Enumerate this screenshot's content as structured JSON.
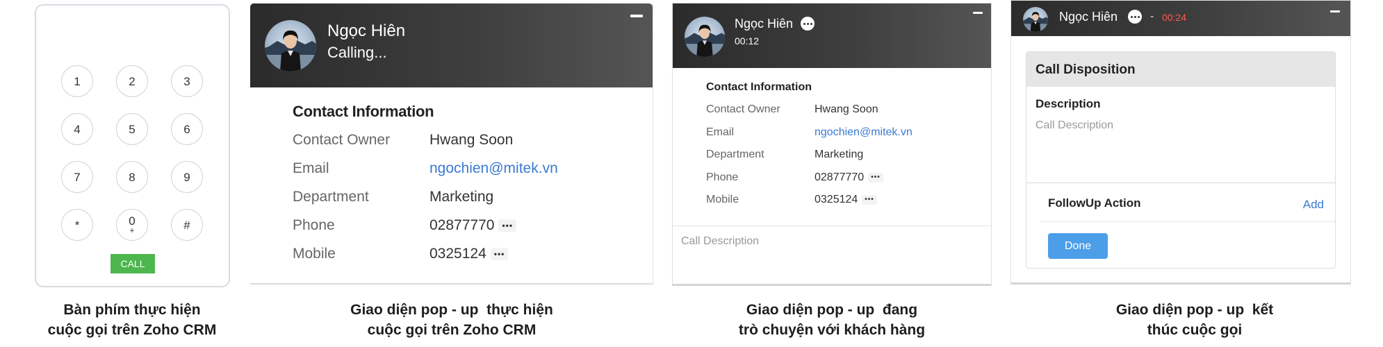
{
  "keypad": {
    "keys": [
      {
        "main": "1",
        "sub": ""
      },
      {
        "main": "2",
        "sub": ""
      },
      {
        "main": "3",
        "sub": ""
      },
      {
        "main": "4",
        "sub": ""
      },
      {
        "main": "5",
        "sub": ""
      },
      {
        "main": "6",
        "sub": ""
      },
      {
        "main": "7",
        "sub": ""
      },
      {
        "main": "8",
        "sub": ""
      },
      {
        "main": "9",
        "sub": ""
      },
      {
        "main": "*",
        "sub": ""
      },
      {
        "main": "0",
        "sub": "+"
      },
      {
        "main": "#",
        "sub": ""
      }
    ],
    "call_label": "CALL",
    "call_color": "#4db64e",
    "caption_line1": "Bàn phím thực hiện",
    "caption_line2": "cuộc gọi trên Zoho CRM"
  },
  "calling_popup": {
    "contact_name": "Ngọc Hiên",
    "status": "Calling...",
    "section_title": "Contact Information",
    "fields": [
      {
        "label": "Contact Owner",
        "value": "Hwang Soon"
      },
      {
        "label": "Email",
        "value": "ngochien@mitek.vn"
      },
      {
        "label": "Department",
        "value": "Marketing"
      },
      {
        "label": "Phone",
        "value": "02877770"
      },
      {
        "label": "Mobile",
        "value": "0325124"
      }
    ],
    "dots_label": "•••",
    "caption_line1": "Giao diện pop - up  thực hiện",
    "caption_line2": "cuộc gọi trên Zoho CRM"
  },
  "incall_popup": {
    "contact_name": "Ngọc Hiên",
    "timer": "00:12",
    "section_title": "Contact Information",
    "fields": [
      {
        "label": "Contact Owner",
        "value": "Hwang Soon"
      },
      {
        "label": "Email",
        "value": "ngochien@mitek.vn"
      },
      {
        "label": "Department",
        "value": "Marketing"
      },
      {
        "label": "Phone",
        "value": "02877770"
      },
      {
        "label": "Mobile",
        "value": "0325124"
      }
    ],
    "dots_label": "•••",
    "description_placeholder": "Call Description",
    "caption_line1": "Giao diện pop - up  đang",
    "caption_line2": "trò chuyện với khách hàng"
  },
  "end_popup": {
    "contact_name": "Ngọc Hiên",
    "separator": "-",
    "timer": "00:24",
    "timer_color": "#ff5a4f",
    "card_title": "Call Disposition",
    "description_label": "Description",
    "description_placeholder": "Call Description",
    "followup_label": "FollowUp Action",
    "add_label": "Add",
    "done_label": "Done",
    "done_color": "#4c9ee8",
    "caption_line1": "Giao diện pop - up  kết",
    "caption_line2": "thúc cuộc gọi"
  },
  "link_color": "#3b7ad1"
}
